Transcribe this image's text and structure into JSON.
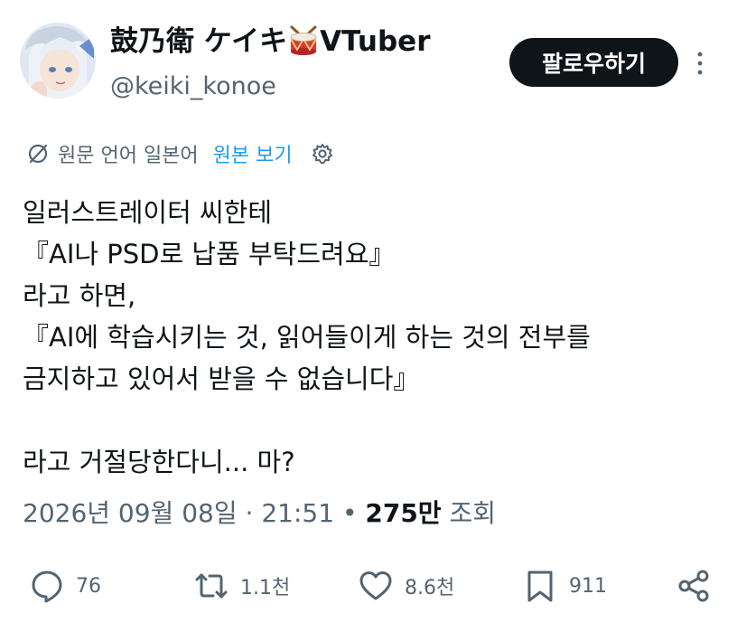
{
  "author": {
    "display_name_before": "鼓乃衛 ケイキ",
    "display_name_after": "VTuber",
    "handle": "@keiki_konoe"
  },
  "follow_label": "팔로우하기",
  "translation": {
    "text": "원문 언어 일본어",
    "show_original": "원본 보기"
  },
  "tweet_lines": [
    "일러스트레이터 씨한테",
    "『AI나 PSD로 납품 부탁드려요』",
    "라고 하면,",
    "『AI에 학습시키는 것, 읽어들이게 하는 것의 전부를",
    "금지하고 있어서 받을 수 없습니다』",
    "",
    "라고 거절당한다니... 마?"
  ],
  "meta": {
    "date": "2026년 09월 08일",
    "separator": "·",
    "time": "21:51",
    "dot": "•",
    "views_count": "275만",
    "views_label": "조회"
  },
  "actions": {
    "replies": "76",
    "retweets": "1.1천",
    "likes": "8.6천",
    "bookmarks": "911"
  },
  "colors": {
    "text_primary": "#0f1419",
    "text_secondary": "#536471",
    "link": "#1d9bf0",
    "button_bg": "#0f1419"
  },
  "icons": [
    "avatar",
    "drum-emoji",
    "more-vertical-icon",
    "translate-icon",
    "gear-icon",
    "reply-icon",
    "retweet-icon",
    "like-icon",
    "bookmark-icon",
    "share-icon"
  ]
}
